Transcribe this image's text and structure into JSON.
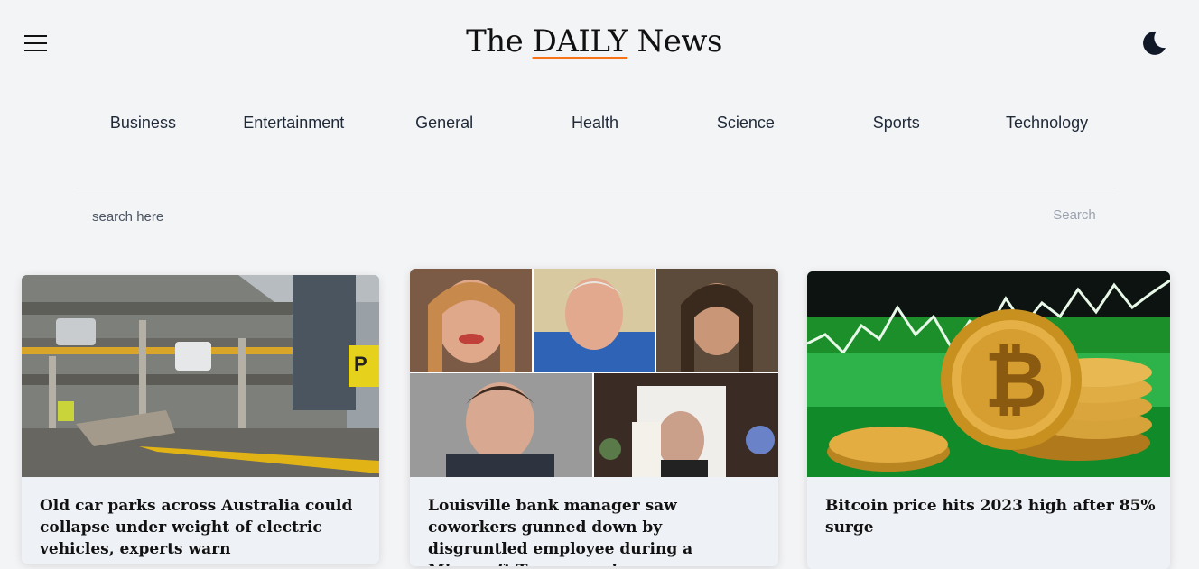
{
  "header": {
    "brand_prefix": "The ",
    "brand_accent": "DAILY",
    "brand_suffix": " News",
    "accent_color": "#f97316"
  },
  "nav": {
    "categories": [
      "Business",
      "Entertainment",
      "General",
      "Health",
      "Science",
      "Sports",
      "Technology"
    ]
  },
  "search": {
    "placeholder": "search here",
    "button_label": "Search"
  },
  "articles": [
    {
      "title": "Old car parks across Australia could collapse under weight of electric vehicles, experts warn",
      "image": "parking-garage-photo"
    },
    {
      "title": "Louisville bank manager saw coworkers gunned down by disgruntled employee during a Microsoft Teams session",
      "image": "victims-collage-photo"
    },
    {
      "title": "Bitcoin price hits 2023 high after 85% surge",
      "image": "bitcoin-coins-photo"
    }
  ],
  "icons": {
    "menu": "hamburger-menu-icon",
    "theme": "moon-icon"
  }
}
